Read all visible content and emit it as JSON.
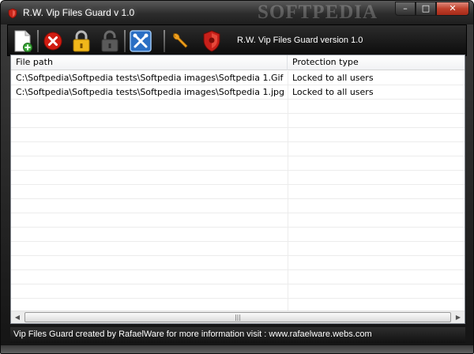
{
  "window": {
    "title": "R.W. Vip Files Guard v 1.0",
    "watermark": "SOFTPEDIA",
    "caption": {
      "minimize": "–",
      "maximize": "□",
      "close": "✕"
    }
  },
  "toolbar": {
    "version_text": "R.W. Vip Files Guard version 1.0",
    "buttons": [
      {
        "icon": "add-file-icon"
      },
      {
        "icon": "remove-icon"
      },
      {
        "icon": "lock-icon"
      },
      {
        "icon": "unlock-icon"
      },
      {
        "icon": "tools-icon"
      },
      {
        "icon": "wrench-icon"
      },
      {
        "icon": "shield-icon"
      }
    ]
  },
  "list": {
    "columns": {
      "path": "File path",
      "protection": "Protection type"
    },
    "rows": [
      {
        "path": "C:\\Softpedia\\Softpedia tests\\Softpedia images\\Softpedia 1.Gif",
        "protection": "Locked to all users"
      },
      {
        "path": "C:\\Softpedia\\Softpedia tests\\Softpedia images\\Softpedia 1.jpg",
        "protection": "Locked to all users"
      }
    ]
  },
  "scrollbar": {
    "left_arrow": "◀",
    "right_arrow": "▶",
    "grip": "|||"
  },
  "status": {
    "text": "Vip Files Guard created by RafaelWare for more information visit : www.rafaelware.webs.com"
  },
  "colors": {
    "chrome_dark": "#141414",
    "close_red": "#c1412c",
    "list_border": "#828790"
  }
}
